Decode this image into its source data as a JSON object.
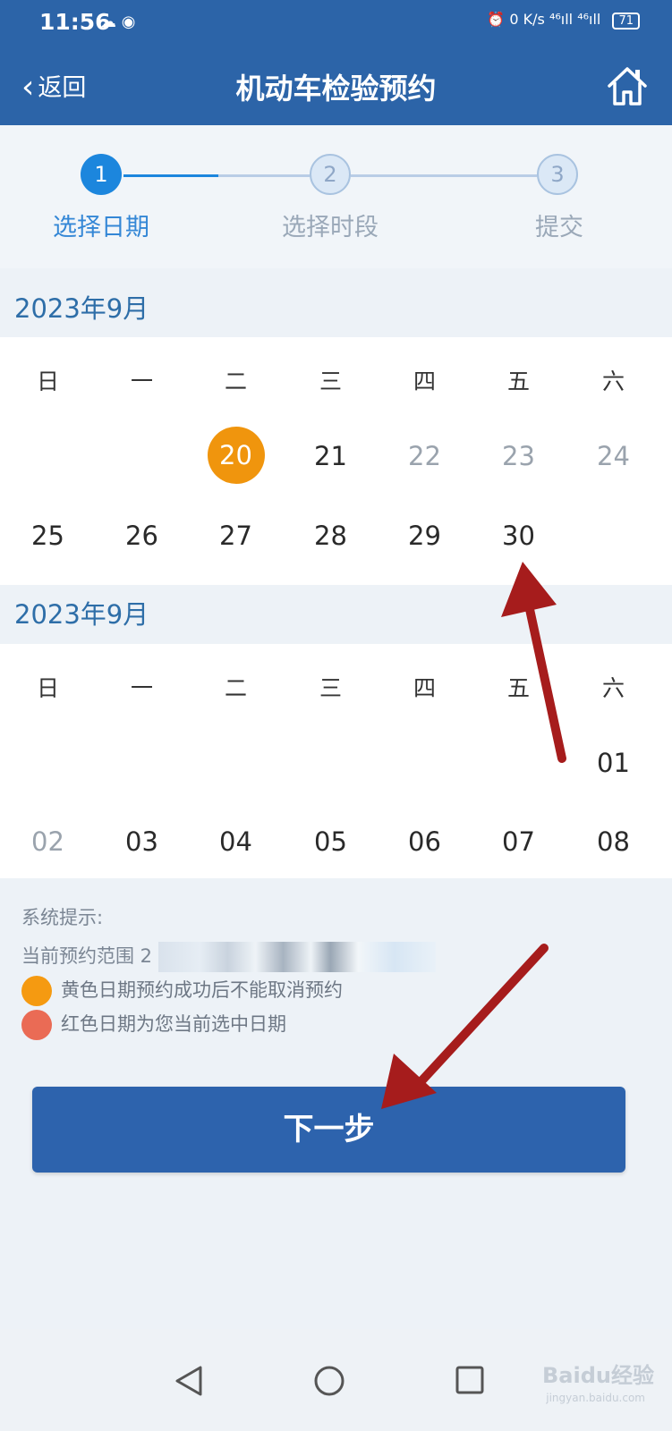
{
  "status": {
    "time": "11:56",
    "left_icons": "☁ ◉",
    "right_icons": "⏰ 0 K/s ⁴⁶ıll ⁴⁶ıll",
    "battery": "71"
  },
  "nav": {
    "back_label": "返回",
    "title": "机动车检验预约",
    "home_icon": "home-icon"
  },
  "steps": [
    {
      "number": "1",
      "label": "选择日期",
      "active": true
    },
    {
      "number": "2",
      "label": "选择时段",
      "active": false
    },
    {
      "number": "3",
      "label": "提交",
      "active": false
    }
  ],
  "weekdays": [
    "日",
    "一",
    "二",
    "三",
    "四",
    "五",
    "六"
  ],
  "calendar1": {
    "title": "2023年9月",
    "row1": [
      "",
      "",
      "20",
      "21",
      "22",
      "23",
      "24"
    ],
    "row2": [
      "25",
      "26",
      "27",
      "28",
      "29",
      "30",
      ""
    ],
    "selected": "20"
  },
  "calendar2": {
    "title": "2023年9月",
    "row1": [
      "",
      "",
      "",
      "",
      "",
      "",
      "01"
    ],
    "row2": [
      "02",
      "03",
      "04",
      "05",
      "06",
      "07",
      "08"
    ]
  },
  "hints": {
    "title": "系统提示:",
    "range_label": "当前预约范围 2",
    "legend_yellow": "黄色日期预约成功后不能取消预约",
    "legend_red": "红色日期为您当前选中日期"
  },
  "colors": {
    "primary": "#2c64a8",
    "selected": "#f0950d",
    "yellow": "#f59a11",
    "red": "#ea6b55",
    "arrow": "#a61c1c"
  },
  "next_button": "下一步",
  "watermark": {
    "brand": "Baidu经验",
    "url": "jingyan.baidu.com"
  }
}
